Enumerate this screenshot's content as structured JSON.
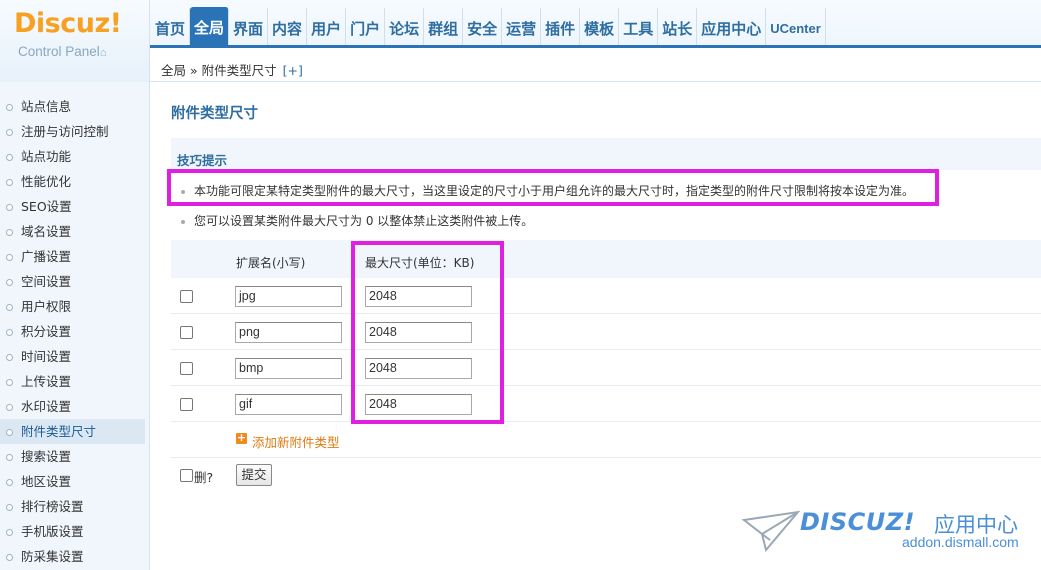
{
  "logo": {
    "brand": "Discuz!",
    "subtitle": "Control Panel"
  },
  "topnav": [
    "首页",
    "全局",
    "界面",
    "内容",
    "用户",
    "门户",
    "论坛",
    "群组",
    "安全",
    "运营",
    "插件",
    "模板",
    "工具",
    "站长",
    "应用中心",
    "UCenter"
  ],
  "topnav_active": "全局",
  "breadcrumb": {
    "text": "全局 » 附件类型尺寸",
    "plus": "[+]"
  },
  "sidebar": [
    "站点信息",
    "注册与访问控制",
    "站点功能",
    "性能优化",
    "SEO设置",
    "域名设置",
    "广播设置",
    "空间设置",
    "用户权限",
    "积分设置",
    "时间设置",
    "上传设置",
    "水印设置",
    "附件类型尺寸",
    "搜索设置",
    "地区设置",
    "排行榜设置",
    "手机版设置",
    "防采集设置"
  ],
  "sidebar_active": "附件类型尺寸",
  "page_title": "附件类型尺寸",
  "tips": {
    "heading": "技巧提示",
    "items": [
      "本功能可限定某特定类型附件的最大尺寸，当这里设定的尺寸小于用户组允许的最大尺寸时，指定类型的附件尺寸限制将按本设定为准。",
      "您可以设置某类附件最大尺寸为 0 以整体禁止这类附件被上传。"
    ]
  },
  "table": {
    "col_ext": "扩展名(小写)",
    "col_size": "最大尺寸(单位：KB)",
    "rows": [
      {
        "ext": "jpg",
        "size": "2048"
      },
      {
        "ext": "png",
        "size": "2048"
      },
      {
        "ext": "bmp",
        "size": "2048"
      },
      {
        "ext": "gif",
        "size": "2048"
      }
    ],
    "add_label": "添加新附件类型",
    "delete_label": "删?",
    "submit_label": "提交"
  },
  "watermark": {
    "title": "DISCUZ!",
    "cn": "应用中心",
    "url": "addon.dismall.com"
  },
  "colors": {
    "accent": "#2b73b7",
    "highlight": "#e020e0",
    "add": "#f08a1c"
  }
}
